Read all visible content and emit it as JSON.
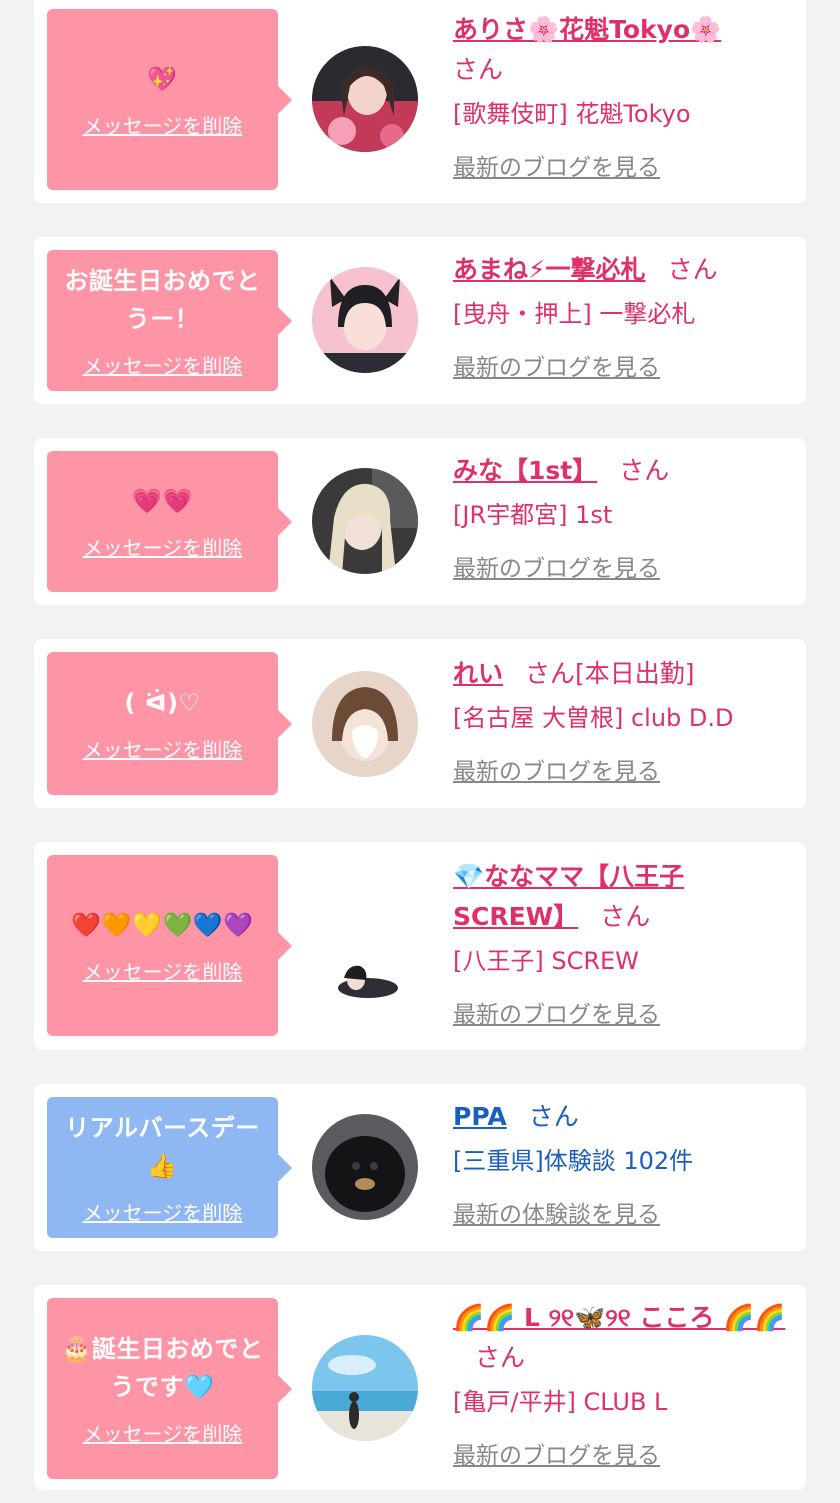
{
  "cards": [
    {
      "message": "💖",
      "delete_label": "メッセージを削除",
      "name": "ありさ🌸花魁Tokyo🌸",
      "suffix": "さん",
      "shop": "[歌舞伎町] 花魁Tokyo",
      "link": "最新のブログを見る",
      "bubble_color": "#fe95a6"
    },
    {
      "message": "お誕生日おめでとうー！",
      "delete_label": "メッセージを削除",
      "name": "あまね⚡一撃必札",
      "suffix": "さん",
      "shop": "[曳舟・押上] 一撃必札",
      "link": "最新のブログを見る",
      "bubble_color": "#fe95a6"
    },
    {
      "message": "💗💗",
      "delete_label": "メッセージを削除",
      "name": "みな【1st】",
      "suffix": "さん",
      "shop": "[JR宇都宮] 1st",
      "link": "最新のブログを見る",
      "bubble_color": "#fe95a6"
    },
    {
      "message": "( ᐛ)♡",
      "delete_label": "メッセージを削除",
      "name": "れい",
      "suffix": "さん[本日出勤]",
      "shop": "[名古屋 大曽根] club D.D",
      "link": "最新のブログを見る",
      "bubble_color": "#fe95a6"
    },
    {
      "message": "❤️🧡💛💚💙💜",
      "delete_label": "メッセージを削除",
      "name": "💎ななママ【八王子SCREW】",
      "suffix": "さん",
      "shop": "[八王子] SCREW",
      "link": "最新のブログを見る",
      "bubble_color": "#fe95a6"
    },
    {
      "message": "リアルバースデー👍",
      "delete_label": "メッセージを削除",
      "name": "PPA",
      "suffix": "さん",
      "shop": "[三重県]体験談 102件",
      "link": "最新の体験談を見る",
      "bubble_color": "#8fb8f2"
    },
    {
      "message": "🎂誕生日おめでとうです🩵",
      "delete_label": "メッセージを削除",
      "name": "🌈🌈 L ୨୧🦋୨୧ こころ 🌈🌈",
      "suffix": "さん",
      "shop": "[亀戸/平井] CLUB L",
      "link": "最新のブログを見る",
      "bubble_color": "#fe95a6"
    }
  ]
}
